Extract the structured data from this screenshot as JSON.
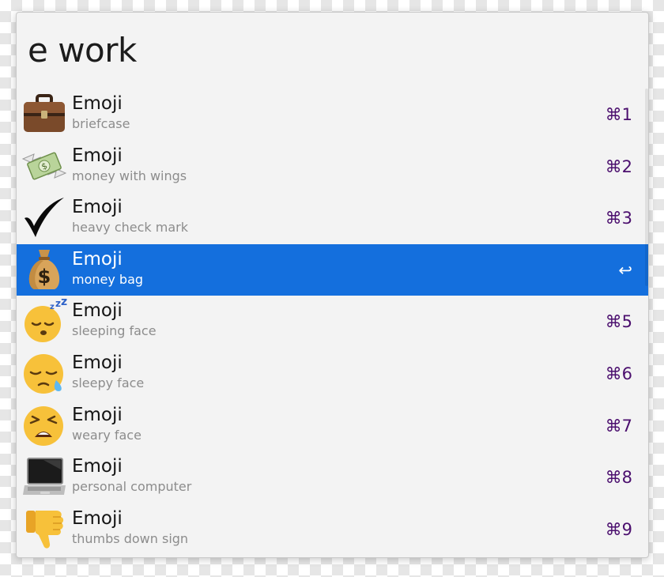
{
  "search": {
    "query": "e work"
  },
  "results": [
    {
      "title": "Emoji",
      "subtitle": "briefcase",
      "shortcut": "⌘1",
      "icon": "briefcase-emoji-icon",
      "selected": false
    },
    {
      "title": "Emoji",
      "subtitle": "money with wings",
      "shortcut": "⌘2",
      "icon": "money-with-wings-emoji-icon",
      "selected": false
    },
    {
      "title": "Emoji",
      "subtitle": "heavy check mark",
      "shortcut": "⌘3",
      "icon": "heavy-check-mark-emoji-icon",
      "selected": false
    },
    {
      "title": "Emoji",
      "subtitle": "money bag",
      "shortcut": "↩",
      "icon": "money-bag-emoji-icon",
      "selected": true
    },
    {
      "title": "Emoji",
      "subtitle": "sleeping face",
      "shortcut": "⌘5",
      "icon": "sleeping-face-emoji-icon",
      "selected": false
    },
    {
      "title": "Emoji",
      "subtitle": "sleepy face",
      "shortcut": "⌘6",
      "icon": "sleepy-face-emoji-icon",
      "selected": false
    },
    {
      "title": "Emoji",
      "subtitle": "weary face",
      "shortcut": "⌘7",
      "icon": "weary-face-emoji-icon",
      "selected": false
    },
    {
      "title": "Emoji",
      "subtitle": "personal computer",
      "shortcut": "⌘8",
      "icon": "personal-computer-emoji-icon",
      "selected": false
    },
    {
      "title": "Emoji",
      "subtitle": "thumbs down sign",
      "shortcut": "⌘9",
      "icon": "thumbs-down-sign-emoji-icon",
      "selected": false
    }
  ],
  "colors": {
    "selection": "#146fdd",
    "shortcut": "#4b0f6e",
    "subtitle": "#8c8c8c",
    "panel_background": "#f3f3f3"
  }
}
